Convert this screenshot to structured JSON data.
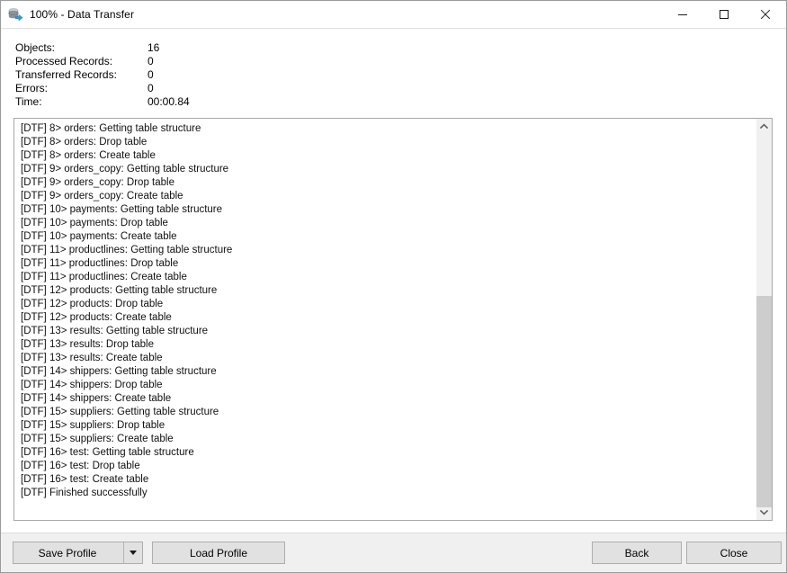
{
  "window": {
    "title": "100% - Data Transfer",
    "icon": "data-transfer-database-icon",
    "controls": {
      "minimize": "minimize-icon",
      "maximize": "maximize-icon",
      "close": "close-icon"
    }
  },
  "stats": [
    {
      "label": "Objects:",
      "value": "16"
    },
    {
      "label": "Processed Records:",
      "value": "0"
    },
    {
      "label": "Transferred Records:",
      "value": "0"
    },
    {
      "label": "Errors:",
      "value": "0"
    },
    {
      "label": "Time:",
      "value": "00:00.84"
    }
  ],
  "log": {
    "lines": [
      "[DTF] 8> orders: Getting table structure",
      "[DTF] 8> orders: Drop table",
      "[DTF] 8> orders: Create table",
      "[DTF] 9> orders_copy: Getting table structure",
      "[DTF] 9> orders_copy: Drop table",
      "[DTF] 9> orders_copy: Create table",
      "[DTF] 10> payments: Getting table structure",
      "[DTF] 10> payments: Drop table",
      "[DTF] 10> payments: Create table",
      "[DTF] 11> productlines: Getting table structure",
      "[DTF] 11> productlines: Drop table",
      "[DTF] 11> productlines: Create table",
      "[DTF] 12> products: Getting table structure",
      "[DTF] 12> products: Drop table",
      "[DTF] 12> products: Create table",
      "[DTF] 13> results: Getting table structure",
      "[DTF] 13> results: Drop table",
      "[DTF] 13> results: Create table",
      "[DTF] 14> shippers: Getting table structure",
      "[DTF] 14> shippers: Drop table",
      "[DTF] 14> shippers: Create table",
      "[DTF] 15> suppliers: Getting table structure",
      "[DTF] 15> suppliers: Drop table",
      "[DTF] 15> suppliers: Create table",
      "[DTF] 16> test: Getting table structure",
      "[DTF] 16> test: Drop table",
      "[DTF] 16> test: Create table",
      "[DTF] Finished successfully"
    ],
    "scrollbar": {
      "up_arrow": "chevron-up-icon",
      "down_arrow": "chevron-down-icon"
    }
  },
  "footer": {
    "save_profile_label": "Save Profile",
    "save_profile_dropdown": "chevron-down-icon",
    "load_profile_label": "Load Profile",
    "back_label": "Back",
    "close_label": "Close"
  },
  "colors": {
    "accent": "#29a3d8",
    "window_bg": "#ffffff",
    "footer_bg": "#f0f0f0",
    "button_bg": "#e1e1e1",
    "button_border": "#adadad",
    "scrollbar_thumb": "#cdcdcd",
    "log_text": "#101010"
  }
}
